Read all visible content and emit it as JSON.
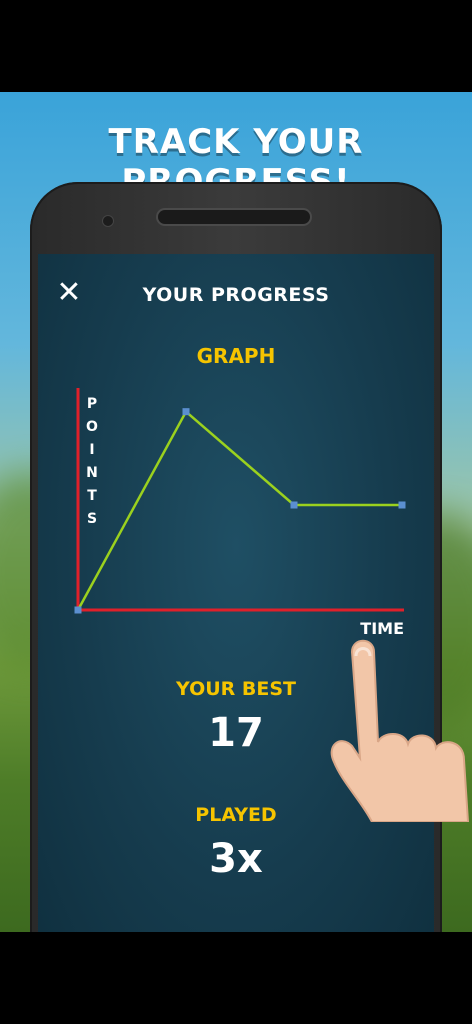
{
  "headline": "TRACK YOUR PROGRESS!",
  "screen": {
    "title": "YOUR PROGRESS",
    "close_icon": "close-icon"
  },
  "graph": {
    "label": "GRAPH"
  },
  "chart_data": {
    "type": "line",
    "title": "",
    "xlabel": "TIME",
    "ylabel": "POINTS",
    "x": [
      0,
      1,
      2,
      3
    ],
    "series": [
      {
        "values": [
          0,
          17,
          9,
          9
        ]
      }
    ],
    "ylim": [
      0,
      18
    ],
    "grid": false,
    "colors": {
      "axes": "#e0202a",
      "line": "#9bd11e",
      "points": "#5b8fd0"
    }
  },
  "stats": {
    "best_label": "YOUR BEST",
    "best_value": "17",
    "played_label": "PLAYED",
    "played_value": "3x"
  },
  "colors": {
    "accent": "#f6c400",
    "screen_bg": "#163c4e"
  }
}
